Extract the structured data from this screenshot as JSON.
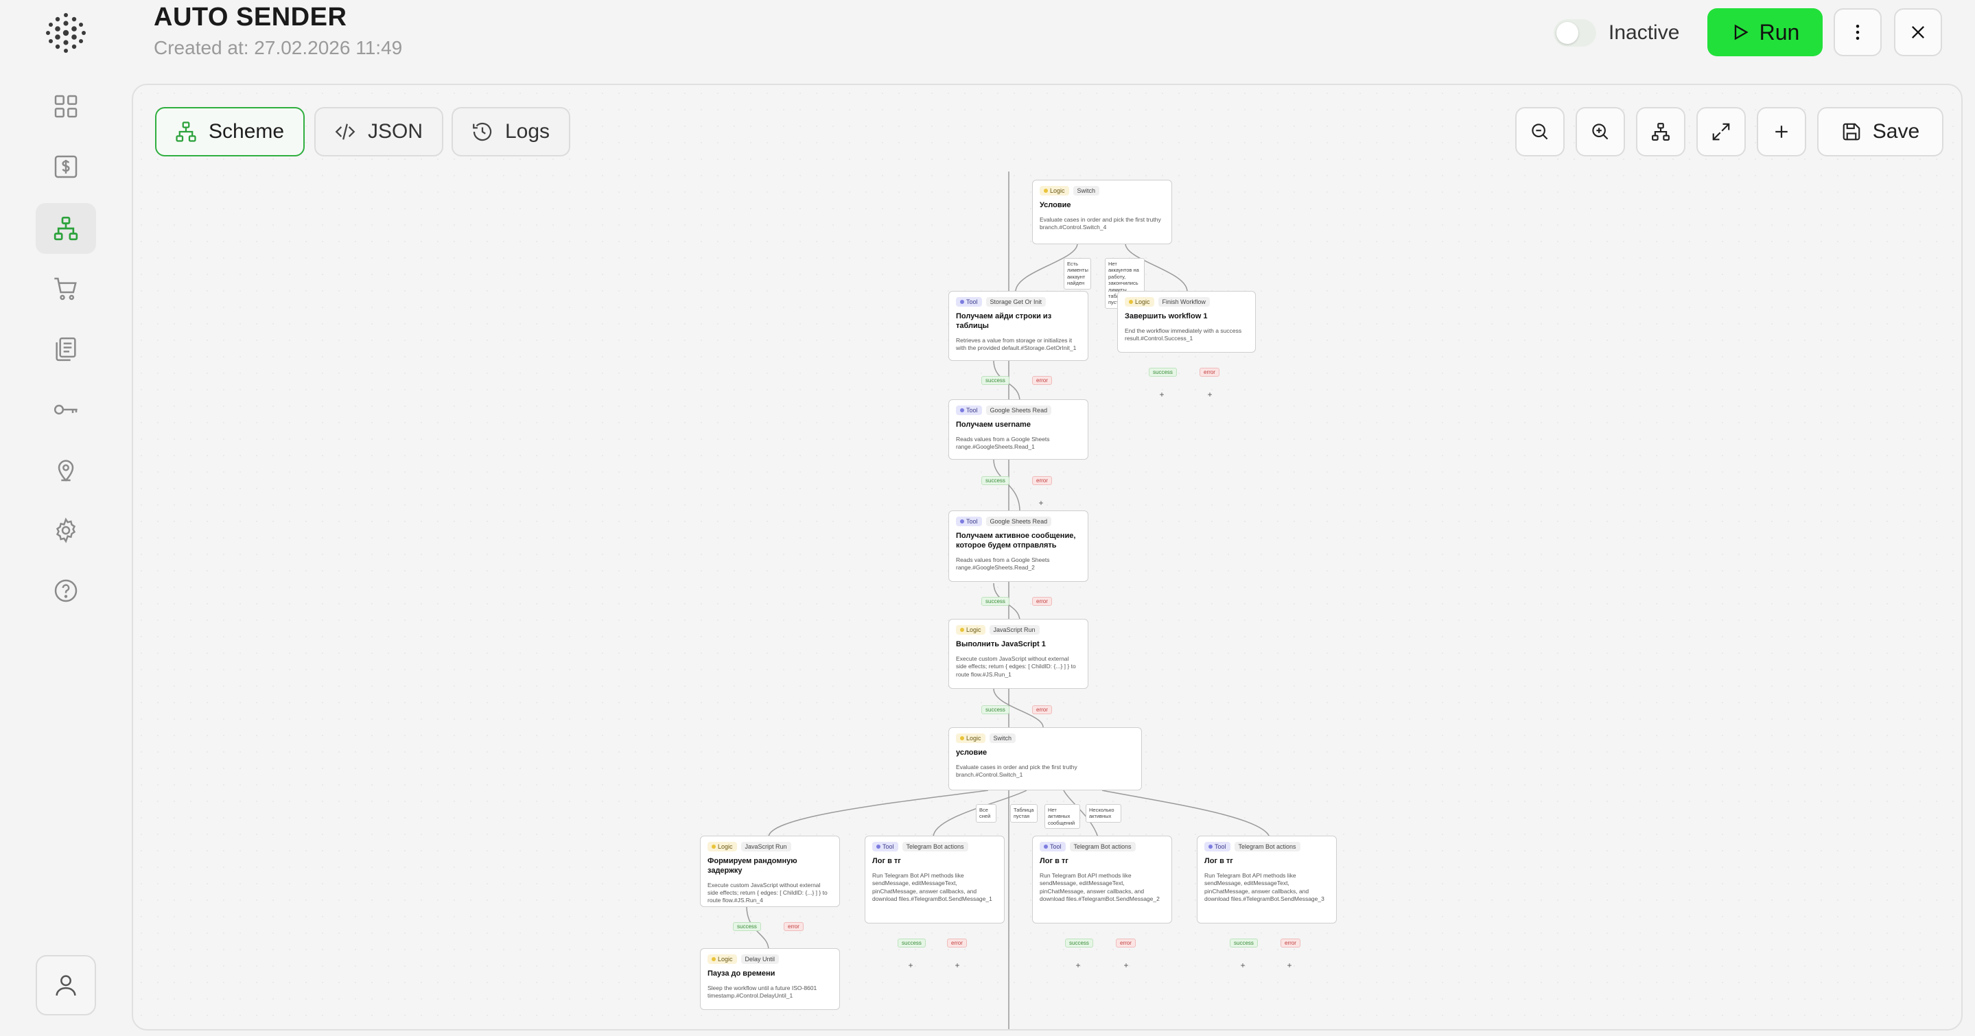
{
  "header": {
    "title": "AUTO SENDER",
    "created": "Created at: 27.02.2026 11:49",
    "status": "Inactive",
    "run_label": "Run"
  },
  "sidebar": {
    "items": [
      {
        "name": "dashboard",
        "icon": "grid-icon"
      },
      {
        "name": "billing",
        "icon": "dollar-icon"
      },
      {
        "name": "workflows",
        "icon": "hierarchy-icon",
        "active": true
      },
      {
        "name": "shop",
        "icon": "cart-icon"
      },
      {
        "name": "documents",
        "icon": "documents-icon"
      },
      {
        "name": "keys",
        "icon": "key-icon"
      },
      {
        "name": "location",
        "icon": "pin-icon"
      },
      {
        "name": "settings",
        "icon": "gear-icon"
      },
      {
        "name": "help",
        "icon": "help-icon"
      }
    ]
  },
  "tabs": [
    {
      "label": "Scheme",
      "icon": "hierarchy-icon",
      "active": true
    },
    {
      "label": "JSON",
      "icon": "code-icon"
    },
    {
      "label": "Logs",
      "icon": "history-icon"
    }
  ],
  "toolbar": {
    "save_label": "Save"
  },
  "ports": {
    "success": "success",
    "error": "error",
    "plus": "+"
  },
  "nodes": [
    {
      "id": "switch4",
      "kind": "Logic",
      "type": "Switch",
      "title": "Условие",
      "desc": "Evaluate cases in order and pick the first truthy branch.#Control.Switch_4"
    },
    {
      "id": "storage1",
      "kind": "Tool",
      "type": "Storage Get Or Init",
      "title": "Получаем айди строки из таблицы",
      "desc": "Retrieves a value from storage or initializes it with the provided default.#Storage.GetOrInit_1"
    },
    {
      "id": "finish1",
      "kind": "Logic",
      "type": "Finish Workflow",
      "title": "Завершить workflow 1",
      "desc": "End the workflow immediately with a success result.#Control.Success_1"
    },
    {
      "id": "sheets1",
      "kind": "Tool",
      "type": "Google Sheets Read",
      "title": "Получаем username",
      "desc": "Reads values from a Google Sheets range.#GoogleSheets.Read_1"
    },
    {
      "id": "sheets2",
      "kind": "Tool",
      "type": "Google Sheets Read",
      "title": "Получаем активное сообщение, которое будем отправлять",
      "desc": "Reads values from a Google Sheets range.#GoogleSheets.Read_2"
    },
    {
      "id": "js1",
      "kind": "Logic",
      "type": "JavaScript Run",
      "title": "Выполнить JavaScript 1",
      "desc": "Execute custom JavaScript without external side effects; return { edges: [ ChildID: {...} ] } to route flow.#JS.Run_1"
    },
    {
      "id": "switch1",
      "kind": "Logic",
      "type": "Switch",
      "title": "условие",
      "desc": "Evaluate cases in order and pick the first truthy branch.#Control.Switch_1"
    },
    {
      "id": "js4",
      "kind": "Logic",
      "type": "JavaScript Run",
      "title": "Формируем рандомную задержку",
      "desc": "Execute custom JavaScript without external side effects; return { edges: [ ChildID: {...} ] } to route flow.#JS.Run_4"
    },
    {
      "id": "tg1",
      "kind": "Tool",
      "type": "Telegram Bot actions",
      "title": "Лог в тг",
      "desc": "Run Telegram Bot API methods like sendMessage, editMessageText, pinChatMessage, answer callbacks, and download files.#TelegramBot.SendMessage_1"
    },
    {
      "id": "tg2",
      "kind": "Tool",
      "type": "Telegram Bot actions",
      "title": "Лог в тг",
      "desc": "Run Telegram Bot API methods like sendMessage, editMessageText, pinChatMessage, answer callbacks, and download files.#TelegramBot.SendMessage_2"
    },
    {
      "id": "tg3",
      "kind": "Tool",
      "type": "Telegram Bot actions",
      "title": "Лог в тг",
      "desc": "Run Telegram Bot API methods like sendMessage, editMessageText, pinChatMessage, answer callbacks, and download files.#TelegramBot.SendMessage_3"
    },
    {
      "id": "delay1",
      "kind": "Logic",
      "type": "Delay Until",
      "title": "Пауза до времени",
      "desc": "Sleep the workflow until a future ISO-8601 timestamp.#Control.DelayUntil_1"
    }
  ],
  "branch_labels": [
    {
      "id": "b1",
      "text": "Есть лименты аккаунт найден"
    },
    {
      "id": "b2",
      "text": "Нет аккаунтов на работу, закончились лимиты таблица пуста"
    },
    {
      "id": "b3",
      "text": "Все сней"
    },
    {
      "id": "b4",
      "text": "Таблица пустая"
    },
    {
      "id": "b5",
      "text": "Нет активных сообщений"
    },
    {
      "id": "b6",
      "text": "Несколько активных"
    }
  ]
}
